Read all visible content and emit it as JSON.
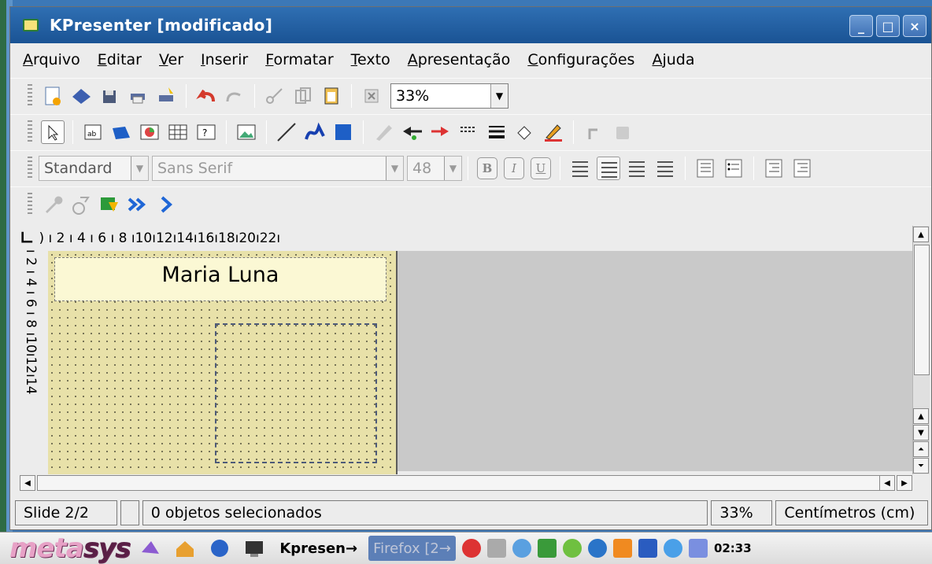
{
  "window": {
    "title": "KPresenter [modificado]",
    "controls": [
      "_",
      "□",
      "×"
    ]
  },
  "menu": [
    "Arquivo",
    "Editar",
    "Ver",
    "Inserir",
    "Formatar",
    "Texto",
    "Apresentação",
    "Configurações",
    "Ajuda"
  ],
  "toolbar": {
    "zoom_value": "33%"
  },
  "format_bar": {
    "style_value": "Standard",
    "font_value": "Sans Serif",
    "size_value": "48",
    "bold": "B",
    "italic": "I",
    "underline": "U"
  },
  "ruler": {
    "h_text": ") ı 2 ı 4 ı 6 ı 8 ı10ı12ı14ı16ı18ı20ı22ı",
    "v_text": "ı 2 ı 4 ı 6 ı 8 ı10ı12ı14"
  },
  "slide": {
    "title_text": "Maria Luna"
  },
  "status": {
    "slide": "Slide 2/2",
    "selection": "0 objetos selecionados",
    "zoom": "33%",
    "units": "Centímetros (cm)"
  },
  "taskbar": {
    "logo_a": "meta",
    "logo_b": "sys",
    "kpresenter": "Kpresen→",
    "firefox": "Firefox [2→",
    "clock": "02:33"
  },
  "colors": {
    "title_bg": "#1f5a9c",
    "slide_bg": "#e8e1a9",
    "title_box": "#fbf8d4"
  }
}
